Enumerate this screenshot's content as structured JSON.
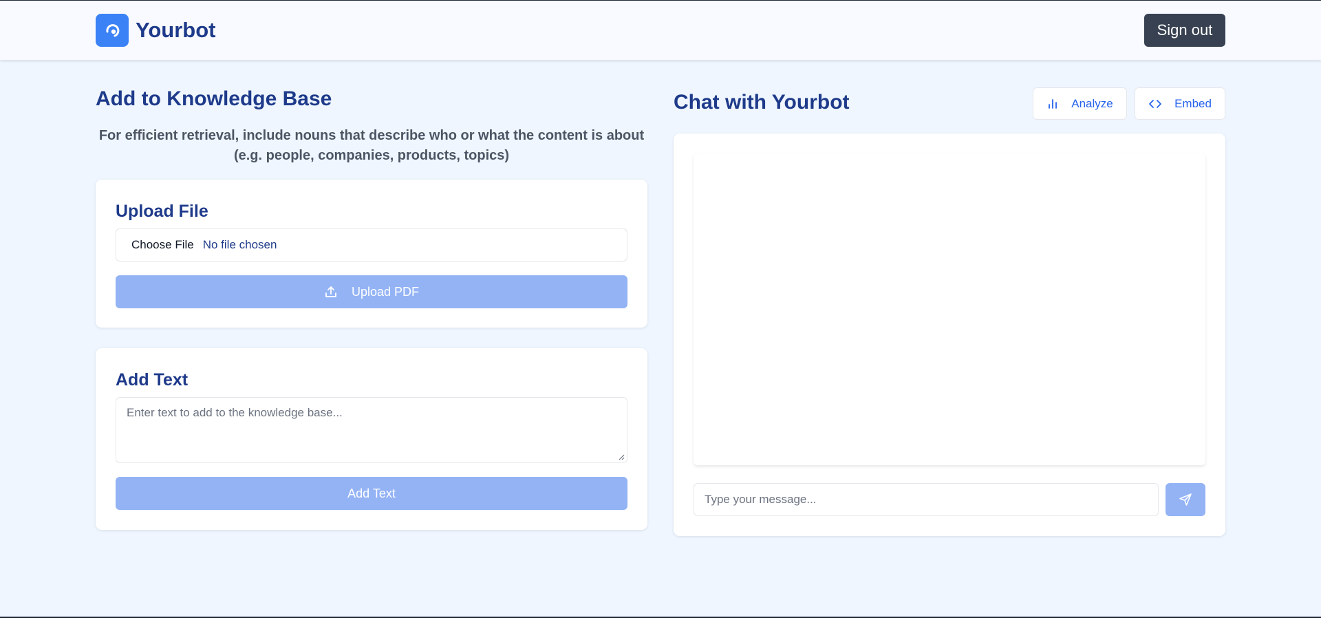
{
  "header": {
    "brand": "Yourbot",
    "sign_out": "Sign out"
  },
  "knowledge": {
    "title": "Add to Knowledge Base",
    "tip_line1": "For efficient retrieval, include nouns that describe who or what the content is about",
    "tip_line2": "(e.g. people, companies, products, topics)",
    "upload": {
      "title": "Upload File",
      "choose_file": "Choose File",
      "no_file": "No file chosen",
      "button": "Upload PDF"
    },
    "text": {
      "title": "Add Text",
      "placeholder": "Enter text to add to the knowledge base...",
      "button": "Add Text"
    }
  },
  "chat": {
    "title": "Chat with Yourbot",
    "analyze": "Analyze",
    "embed": "Embed",
    "placeholder": "Type your message..."
  },
  "colors": {
    "accent": "#3b82f6",
    "heading": "#1e3a8a",
    "button_disabled": "#93b3f5"
  }
}
